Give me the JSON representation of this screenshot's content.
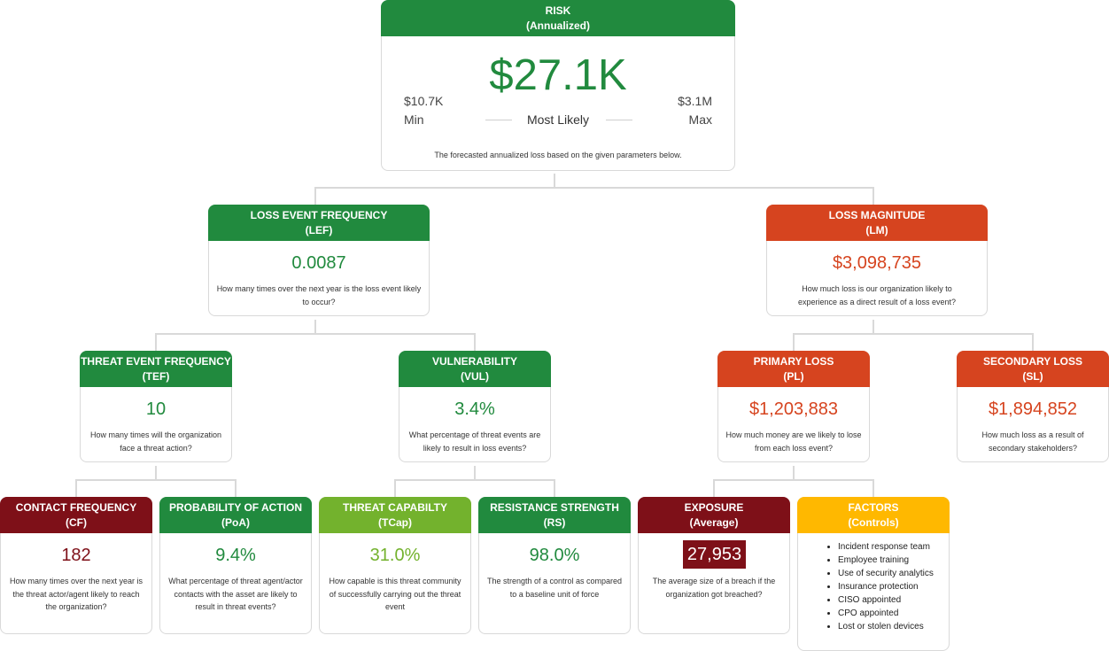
{
  "colors": {
    "green": "#218a3e",
    "orange": "#d6441f",
    "darkred": "#7e1018",
    "lightgreen": "#73b22d",
    "amber": "#ffb800"
  },
  "risk": {
    "title": "RISK",
    "subtitle": "(Annualized)",
    "value": "$27.1K",
    "min_value": "$10.7K",
    "min_label": "Min",
    "max_value": "$3.1M",
    "max_label": "Max",
    "most_likely": "Most Likely",
    "desc": "The forecasted annualized loss based on the given parameters below."
  },
  "lef": {
    "title": "LOSS EVENT FREQUENCY",
    "abbr": "(LEF)",
    "value": "0.0087",
    "desc": "How many times over the next year is the loss event likely to occur?"
  },
  "lm": {
    "title": "LOSS MAGNITUDE",
    "abbr": "(LM)",
    "value": "$3,098,735",
    "desc": "How much loss is our organization likely to experience as a direct result of a loss event?"
  },
  "tef": {
    "title": "THREAT EVENT FREQUENCY",
    "abbr": "(TEF)",
    "value": "10",
    "desc": "How many times will the organization face a threat action?"
  },
  "vul": {
    "title": "VULNERABILITY",
    "abbr": "(VUL)",
    "value": "3.4%",
    "desc": "What percentage of threat events are likely to result in loss events?"
  },
  "pl": {
    "title": "PRIMARY LOSS",
    "abbr": "(PL)",
    "value": "$1,203,883",
    "desc": "How much money are we likely to lose from each loss event?"
  },
  "sl": {
    "title": "SECONDARY LOSS",
    "abbr": "(SL)",
    "value": "$1,894,852",
    "desc": "How much loss as a result of secondary stakeholders?"
  },
  "cf": {
    "title": "CONTACT FREQUENCY",
    "abbr": "(CF)",
    "value": "182",
    "desc": "How many times over the next year is the threat actor/agent likely to reach the organization?"
  },
  "poa": {
    "title": "PROBABILITY OF ACTION",
    "abbr": "(PoA)",
    "value": "9.4%",
    "desc": "What percentage of threat agent/actor contacts with the asset are likely to result in threat events?"
  },
  "tcap": {
    "title": "THREAT CAPABILTY",
    "abbr": "(TCap)",
    "value": "31.0%",
    "desc": "How capable is this threat community of successfully carrying out the threat event"
  },
  "rs": {
    "title": "RESISTANCE STRENGTH",
    "abbr": "(RS)",
    "value": "98.0%",
    "desc": "The strength of a control as compared to a baseline unit of force"
  },
  "exposure": {
    "title": "EXPOSURE",
    "abbr": "(Average)",
    "value": "27,953",
    "desc": "The average size of a breach if the organization got breached?"
  },
  "factors": {
    "title": "FACTORS",
    "abbr": "(Controls)",
    "items": [
      "Incident response team",
      "Employee training",
      "Use of security analytics",
      "Insurance protection",
      "CISO appointed",
      "CPO appointed",
      "Lost or stolen devices"
    ]
  }
}
